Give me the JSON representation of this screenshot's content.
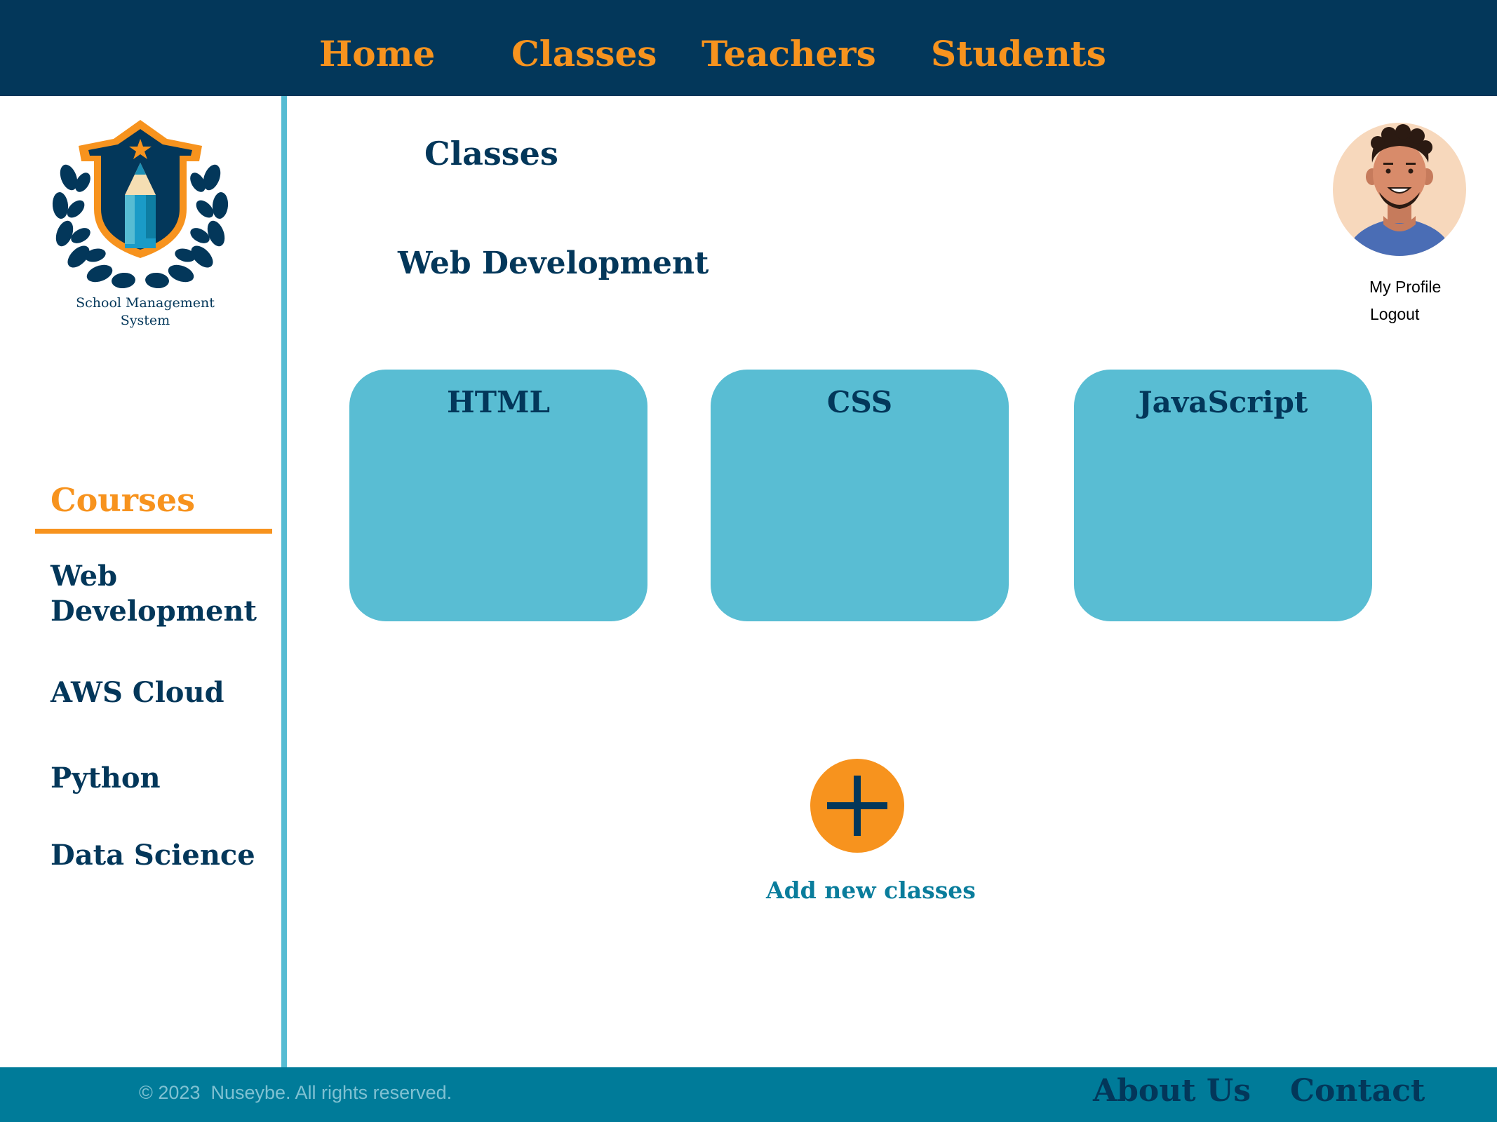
{
  "colors": {
    "navy": "#03375a",
    "orange": "#f7931e",
    "card_blue": "#59bdd3",
    "footer_teal": "#007b99",
    "link_teal": "#0a7d9c"
  },
  "nav": {
    "items": [
      {
        "label": "Home"
      },
      {
        "label": "Classes"
      },
      {
        "label": "Teachers"
      },
      {
        "label": "Students"
      }
    ]
  },
  "brand": {
    "logo_icon": "shield-pencil-laurel-icon",
    "name_line1": "School Management",
    "name_line2": "System"
  },
  "sidebar": {
    "courses_heading": "Courses",
    "items": [
      {
        "label": "Web Development"
      },
      {
        "label": "AWS Cloud"
      },
      {
        "label": "Python"
      },
      {
        "label": "Data Science"
      }
    ]
  },
  "main": {
    "page_title": "Classes",
    "section_title": "Web Development",
    "classes": [
      {
        "title": "HTML"
      },
      {
        "title": "CSS"
      },
      {
        "title": "JavaScript"
      }
    ],
    "add_icon": "plus-icon",
    "add_label": "Add new classes"
  },
  "profile": {
    "avatar_icon": "user-avatar-icon",
    "my_profile": "My Profile",
    "logout": "Logout"
  },
  "footer": {
    "copyright": "© 2023  Nuseybe. All rights reserved.",
    "about": "About Us",
    "contact": "Contact"
  }
}
